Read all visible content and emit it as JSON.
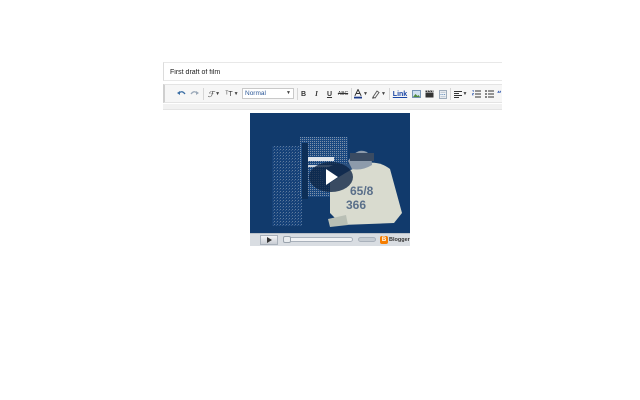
{
  "post": {
    "title": "First draft of film"
  },
  "toolbar": {
    "font_glyph": "ℱ",
    "size_glyph": "ᵀT",
    "format_value": "Normal",
    "bold": "B",
    "italic": "I",
    "underline": "U",
    "strike": "ABC",
    "link": "Link"
  },
  "video": {
    "shirt_text": "65/8\n366",
    "branding": "Blogger",
    "colors": {
      "screen": "#113a6c",
      "controls": "#d9dde2",
      "brand_orange": "#f57d00"
    }
  }
}
